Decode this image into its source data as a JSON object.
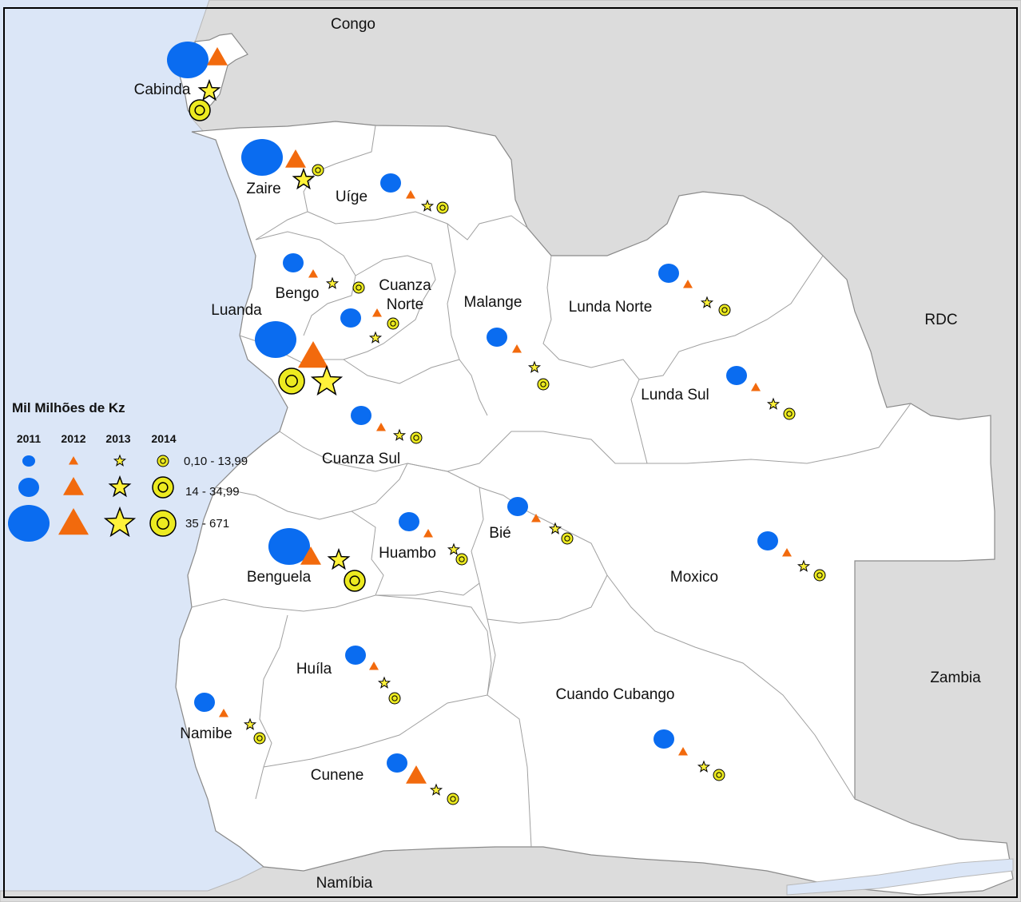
{
  "colors": {
    "ocean": "#dbe6f7",
    "neighbor": "#dcdcdc",
    "land": "#ffffff",
    "border": "#9a9a9a",
    "circle_2011": "#0a6cf0",
    "triangle_2012": "#f26a0d",
    "star_2013": "#fff23a",
    "ring_2014": "#ecea20"
  },
  "neighbors": {
    "congo": "Congo",
    "rdc": "RDC",
    "zambia": "Zambia",
    "namibia": "Namíbia"
  },
  "legend": {
    "title": "Mil Milhões de Kz",
    "years": [
      "2011",
      "2012",
      "2013",
      "2014"
    ],
    "ranges": [
      "0,10 - 13,99",
      "14 - 34,99",
      "35 - 671"
    ]
  },
  "provinces": [
    {
      "id": "cabinda",
      "name": "Cabinda",
      "classes": [
        3,
        2,
        2,
        2
      ]
    },
    {
      "id": "zaire",
      "name": "Zaire",
      "classes": [
        3,
        2,
        2,
        1
      ]
    },
    {
      "id": "uige",
      "name": "Uíge",
      "classes": [
        2,
        1,
        1,
        1
      ]
    },
    {
      "id": "bengo",
      "name": "Bengo",
      "classes": [
        2,
        1,
        1,
        1
      ]
    },
    {
      "id": "cuanza-norte",
      "name_lines": [
        "Cuanza",
        "Norte"
      ],
      "classes": [
        2,
        1,
        1,
        1
      ]
    },
    {
      "id": "luanda",
      "name": "Luanda",
      "classes": [
        3,
        3,
        3,
        3
      ]
    },
    {
      "id": "malange",
      "name": "Malange",
      "classes": [
        2,
        1,
        1,
        1
      ]
    },
    {
      "id": "lunda-norte",
      "name": "Lunda Norte",
      "classes": [
        2,
        1,
        1,
        1
      ]
    },
    {
      "id": "lunda-sul",
      "name": "Lunda Sul",
      "classes": [
        2,
        1,
        1,
        1
      ]
    },
    {
      "id": "cuanza-sul",
      "name": "Cuanza Sul",
      "classes": [
        2,
        1,
        1,
        1
      ]
    },
    {
      "id": "benguela",
      "name": "Benguela",
      "classes": [
        3,
        2,
        2,
        2
      ]
    },
    {
      "id": "huambo",
      "name": "Huambo",
      "classes": [
        2,
        1,
        1,
        1
      ]
    },
    {
      "id": "bie",
      "name": "Bié",
      "classes": [
        2,
        1,
        1,
        1
      ]
    },
    {
      "id": "moxico",
      "name": "Moxico",
      "classes": [
        2,
        1,
        1,
        1
      ]
    },
    {
      "id": "huila",
      "name": "Huíla",
      "classes": [
        2,
        1,
        1,
        1
      ]
    },
    {
      "id": "namibe",
      "name": "Namibe",
      "classes": [
        2,
        1,
        1,
        1
      ]
    },
    {
      "id": "cunene",
      "name": "Cunene",
      "classes": [
        2,
        2,
        1,
        1
      ]
    },
    {
      "id": "cuando-cubango",
      "name": "Cuando Cubango",
      "classes": [
        2,
        1,
        1,
        1
      ]
    }
  ]
}
